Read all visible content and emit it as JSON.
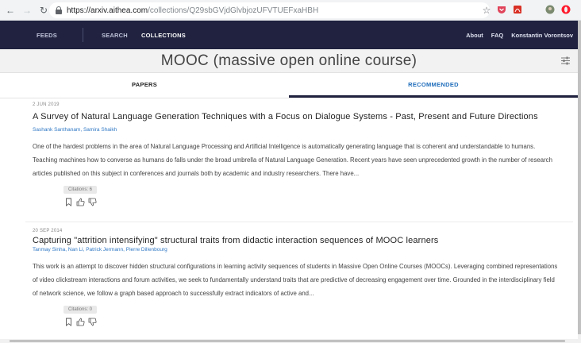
{
  "browser": {
    "url_host": "https://arxiv.aithea.com",
    "url_path": "/collections/Q29sbGVjdGlvbjozUFVTUEFxaHBH"
  },
  "header": {
    "nav": [
      "FEEDS",
      "SEARCH",
      "COLLECTIONS"
    ],
    "about": "About",
    "faq": "FAQ",
    "user": "Konstantin Vorontsov"
  },
  "collection": {
    "title": "MOOC (massive open online course)"
  },
  "tabs": [
    "PAPERS",
    "RECOMMENDED"
  ],
  "papers": [
    {
      "date": "2 JUN 2019",
      "title": "A Survey of Natural Language Generation Techniques with a Focus on Dialogue Systems - Past, Present and Future Directions",
      "authors": "Sashank Santhanam, Samira Shaikh",
      "abstract": "One of the hardest problems in the area of Natural Language Processing and Artificial Intelligence is automatically generating language that is coherent and understandable to humans. Teaching machines how to converse as humans do falls under the broad umbrella of Natural Language Generation. Recent years have seen unprecedented growth in the number of research articles published on this subject in conferences and journals both by academic and industry researchers. There have...",
      "citations": "Citations: 6"
    },
    {
      "date": "20 SEP 2014",
      "title": "Capturing \"attrition intensifying\" structural traits from didactic interaction sequences of MOOC learners",
      "authors": "Tanmay Sinha, Nan Li, Patrick Jermann, Pierre Dillenbourg",
      "abstract": "This work is an attempt to discover hidden structural configurations in learning activity sequences of students in Massive Open Online Courses (MOOCs). Leveraging combined representations of video clickstream interactions and forum activities, we seek to fundamentally understand traits that are predictive of decreasing engagement over time. Grounded in the interdisciplinary field of network science, we follow a graph based approach to successfully extract indicators of active and...",
      "citations": "Citations: 0"
    }
  ],
  "colors": {
    "header_bg": "#20223f",
    "accent": "#1f6dbb",
    "author_link": "#2f78c4"
  }
}
